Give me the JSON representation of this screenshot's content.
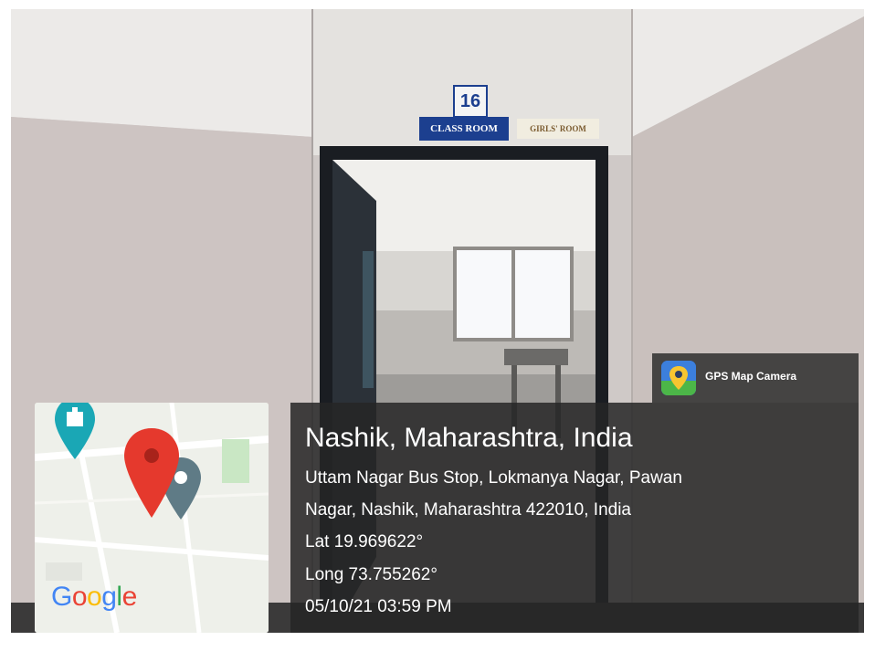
{
  "signs": {
    "room_number": "16",
    "class_room": "CLASS ROOM",
    "girls_room": "GIRLS' ROOM"
  },
  "app_badge": {
    "label": "GPS Map Camera",
    "icon": "gps-map-camera-app-icon"
  },
  "location": {
    "city_line": "Nashik, Maharashtra, India",
    "address_line_1": "Uttam Nagar Bus Stop, Lokmanya Nagar, Pawan",
    "address_line_2": "Nagar, Nashik, Maharashtra 422010, India",
    "latitude": "Lat 19.969622°",
    "longitude": "Long 73.755262°",
    "timestamp": "05/10/21 03:59 PM"
  },
  "map": {
    "google_letters": [
      "G",
      "o",
      "o",
      "g",
      "l",
      "e"
    ],
    "google_colors": [
      "#4285f4",
      "#ea4335",
      "#fbbc05",
      "#4285f4",
      "#34a853",
      "#ea4335"
    ],
    "pin_color": "#e5392d",
    "marker_teal": "#1aa7b5",
    "marker_gray": "#5f7b86"
  },
  "colors": {
    "wall": "#cfc9c7",
    "overlay": "#262626",
    "door_frame": "#1a1d22"
  }
}
